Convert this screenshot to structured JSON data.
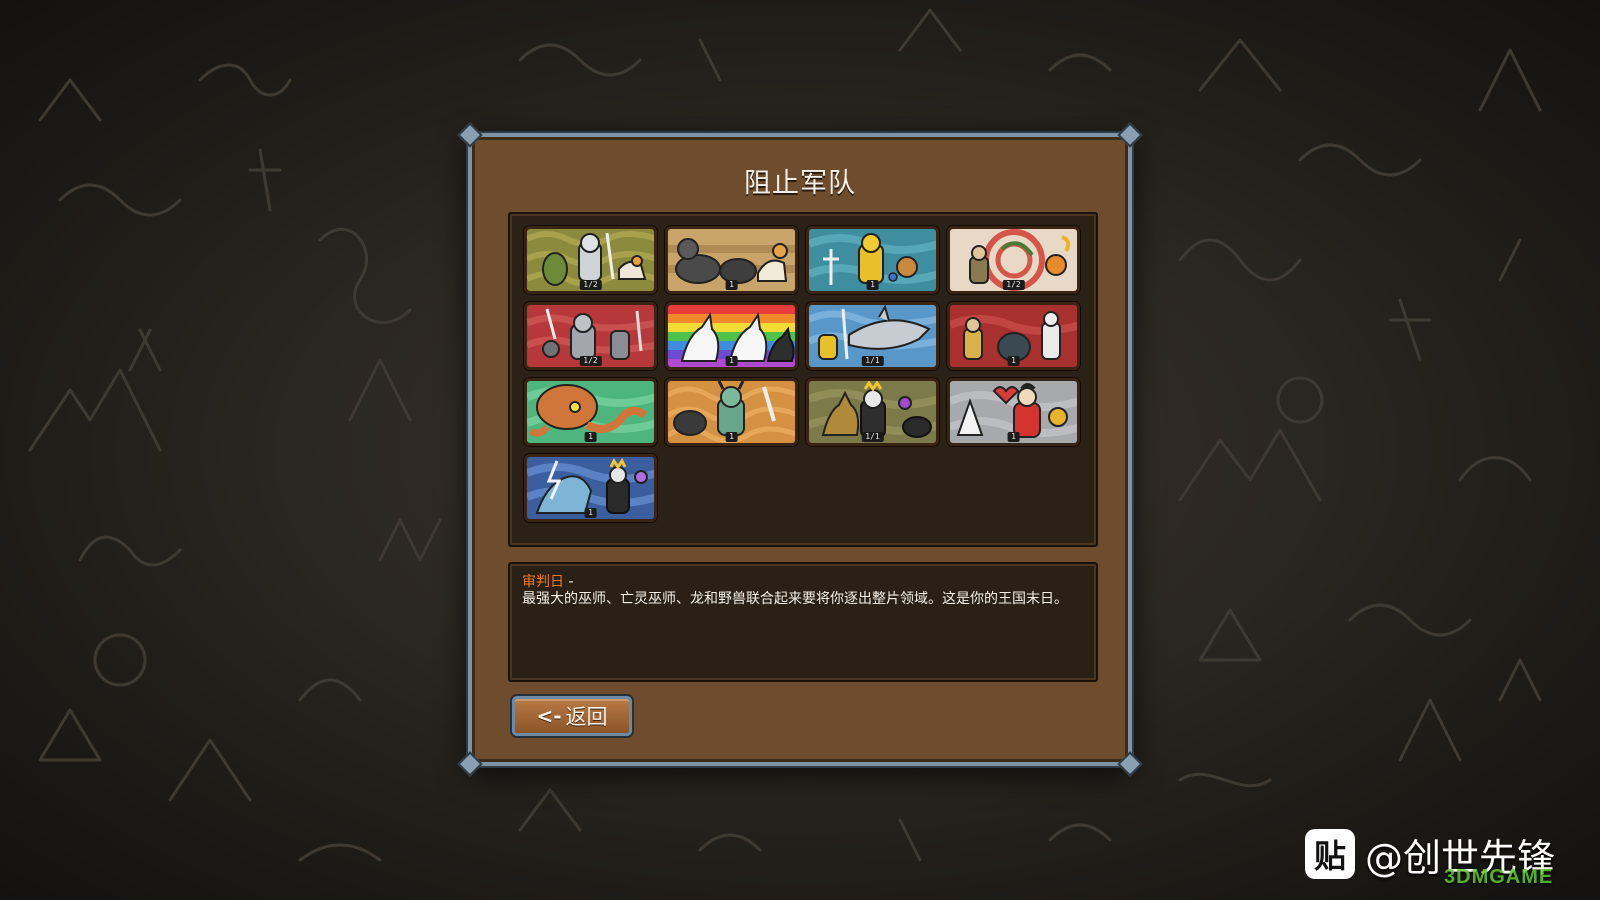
{
  "dialog": {
    "title": "阻止军队",
    "back_arrow": "<-",
    "back_label": "返回"
  },
  "armies": [
    {
      "count": "1/2",
      "theme": "olive-knight"
    },
    {
      "count": "1",
      "theme": "tan-cavalry"
    },
    {
      "count": "1",
      "theme": "teal-golden-knight"
    },
    {
      "count": "1/2",
      "theme": "red-swirl-archers"
    },
    {
      "count": "1/2",
      "theme": "red-knights"
    },
    {
      "count": "1",
      "theme": "rainbow-unicorns"
    },
    {
      "count": "1/1",
      "theme": "blue-shark"
    },
    {
      "count": "1",
      "theme": "red-dark-army"
    },
    {
      "count": "1",
      "theme": "green-octopus"
    },
    {
      "count": "1",
      "theme": "orange-demon"
    },
    {
      "count": "1/1",
      "theme": "olive-necro-king"
    },
    {
      "count": "1",
      "theme": "grey-red-samurai"
    },
    {
      "count": "1",
      "theme": "blue-storm-king"
    }
  ],
  "description": {
    "title": "审判日",
    "dash": " -",
    "body": "最强大的巫师、亡灵巫师、龙和野兽联合起来要将你逐出整片领域。这是你的王国末日。"
  },
  "watermark": {
    "icon_char": "贴",
    "text": "@创世先锋",
    "site": "3DMGAME"
  }
}
